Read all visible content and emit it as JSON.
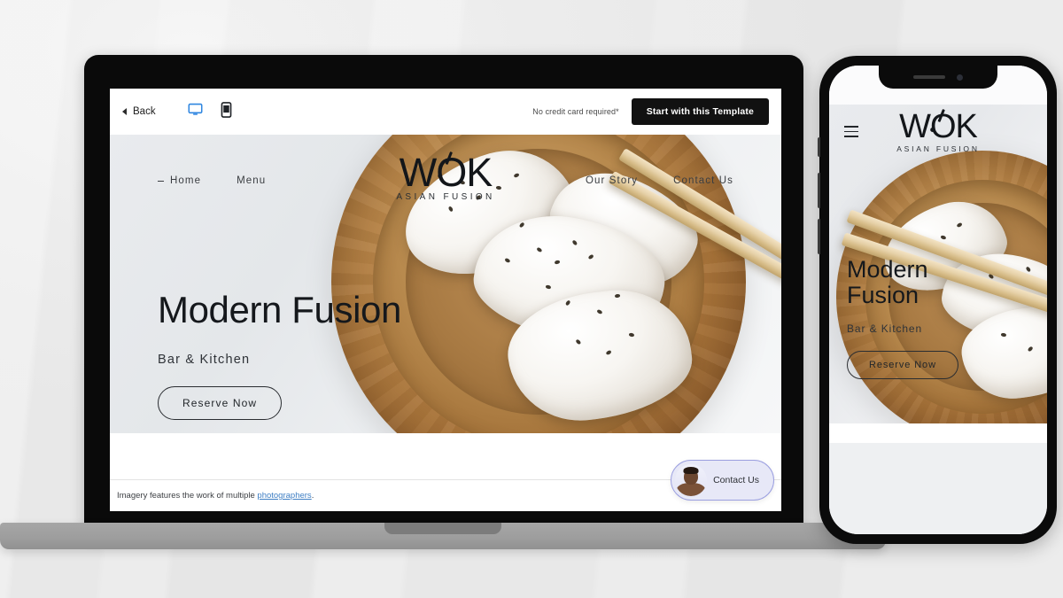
{
  "editor": {
    "back_label": "Back",
    "desktop_icon": "desktop-monitor-icon",
    "mobile_icon": "mobile-phone-icon",
    "disclaimer": "No credit card required*",
    "cta_label": "Start with this Template"
  },
  "site": {
    "brand": {
      "mark": "WOK",
      "tagline": "ASIAN FUSION"
    },
    "nav_left": [
      {
        "label": "Home",
        "active": true
      },
      {
        "label": "Menu",
        "active": false
      }
    ],
    "nav_right": [
      {
        "label": "Our Story",
        "active": false
      },
      {
        "label": "Contact Us",
        "active": false
      }
    ],
    "hero": {
      "title": "Modern Fusion",
      "subtitle": "Bar & Kitchen",
      "button": "Reserve Now"
    },
    "footer": {
      "text_before": "Imagery features the work of multiple ",
      "link": "photographers",
      "text_after": "."
    },
    "chat": {
      "label": "Contact Us",
      "avatar": "person-avatar"
    }
  },
  "mobile": {
    "menu_icon": "hamburger-menu-icon",
    "brand": {
      "mark": "WOK",
      "tagline": "ASIAN FUSION"
    },
    "hero": {
      "title": "Modern Fusion",
      "subtitle": "Bar & Kitchen",
      "button": "Reserve Now"
    }
  },
  "colors": {
    "accent_blue": "#2f86e0",
    "cta_dark": "#111111",
    "link_blue": "#3f7fc4",
    "chat_border": "#9b9fe0"
  }
}
